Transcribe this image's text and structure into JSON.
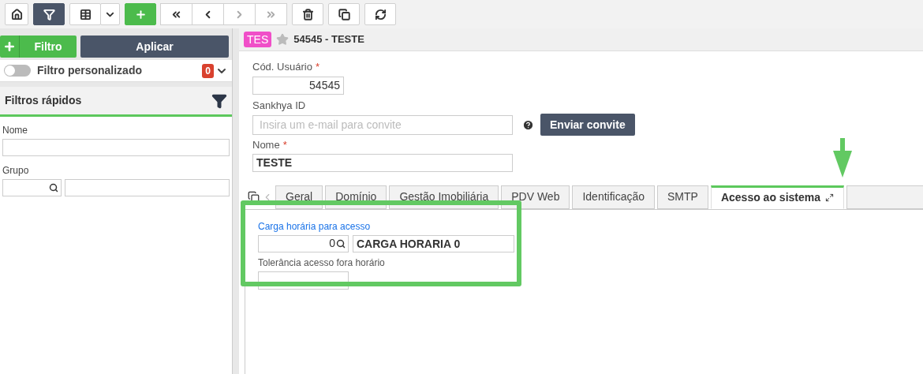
{
  "toolbar": [
    {
      "kind": "home",
      "selected": false
    },
    {
      "kind": "filter",
      "selected": true
    },
    {
      "kind": "grid",
      "selected": false
    },
    {
      "kind": "caret",
      "selected": false
    },
    {
      "kind": "add",
      "selected": false
    }
  ],
  "navigation": [
    {
      "kind": "first",
      "disabled": false
    },
    {
      "kind": "prev",
      "disabled": false
    },
    {
      "kind": "next",
      "disabled": true
    },
    {
      "kind": "last",
      "disabled": true
    }
  ],
  "actions": [
    {
      "kind": "delete"
    },
    {
      "kind": "copy"
    },
    {
      "kind": "refresh"
    }
  ],
  "filter_panel": {
    "add_label": "Filtro",
    "apply_label": "Aplicar",
    "custom_filter": {
      "label": "Filtro personalizado",
      "on": false,
      "count": "0"
    },
    "quick_filters_title": "Filtros rápidos",
    "fields": [
      {
        "label": "Nome",
        "kind": "text"
      },
      {
        "label": "Grupo",
        "kind": "lookup"
      }
    ]
  },
  "record": {
    "badge": "TES",
    "favorite": false,
    "title": "54545 - TESTE"
  },
  "form": {
    "required_mark": "*",
    "user_code": {
      "label": "Cód. Usuário",
      "required": true,
      "value": "54545"
    },
    "sankhya_id": {
      "label": "Sankhya ID",
      "placeholder": "Insira um e-mail para convite",
      "button": "Enviar convite"
    },
    "name": {
      "label": "Nome",
      "required": true,
      "value": "TESTE"
    }
  },
  "tabs": [
    {
      "label": "Geral",
      "selected": false
    },
    {
      "label": "Domínio",
      "selected": false
    },
    {
      "label": "Gestão Imobiliária",
      "selected": false
    },
    {
      "label": "PDV Web",
      "selected": false
    },
    {
      "label": "Identificação",
      "selected": false
    },
    {
      "label": "SMTP",
      "selected": false
    },
    {
      "label": "Acesso ao sistema",
      "selected": true
    }
  ],
  "tab_content": {
    "schedule": {
      "label": "Carga horária para acesso",
      "code": "0",
      "description": "CARGA HORARIA 0"
    },
    "tolerance": {
      "label": "Tolerância acesso fora horário"
    }
  }
}
